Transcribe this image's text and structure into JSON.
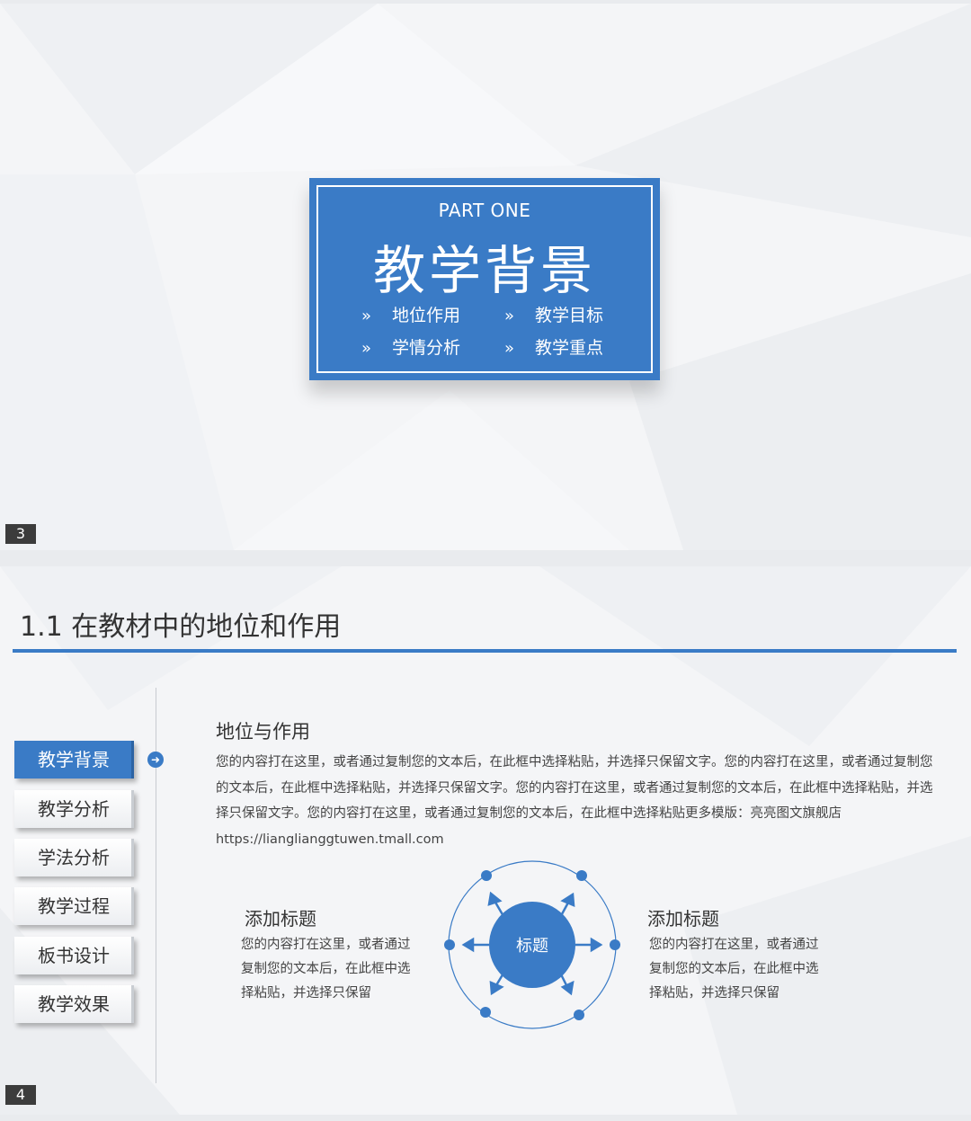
{
  "slide3": {
    "number": "3",
    "part": "PART ONE",
    "title": "教学背景",
    "chevron": "»",
    "items": [
      "地位作用",
      "教学目标",
      "学情分析",
      "教学重点"
    ]
  },
  "slide4": {
    "number": "4",
    "title": "1.1 在教材中的地位和作用",
    "nav": [
      "教学背景",
      "教学分析",
      "学法分析",
      "教学过程",
      "板书设计",
      "教学效果"
    ],
    "active_nav": "教学背景",
    "arrow_icon": "arrow-right-circle-icon",
    "section_heading": "地位与作用",
    "paragraph": "您的内容打在这里，或者通过复制您的文本后，在此框中选择粘贴，并选择只保留文字。您的内容打在这里，或者通过复制您的文本后，在此框中选择粘贴，并选择只保留文字。您的内容打在这里，或者通过复制您的文本后，在此框中选择粘贴，并选择只保留文字。您的内容打在这里，或者通过复制您的文本后，在此框中选择粘贴更多模版：亮亮图文旗舰店https://lianglianggtuwen.tmall.com",
    "left_block": {
      "title": "添加标题",
      "text": "您的内容打在这里，或者通过复制您的文本后，在此框中选择粘贴，并选择只保留"
    },
    "center_label": "标题",
    "right_block": {
      "title": "添加标题",
      "text": "您的内容打在这里，或者通过复制您的文本后，在此框中选择粘贴，并选择只保留"
    }
  },
  "colors": {
    "accent": "#3a7bc6",
    "background": "#f4f5f7"
  }
}
